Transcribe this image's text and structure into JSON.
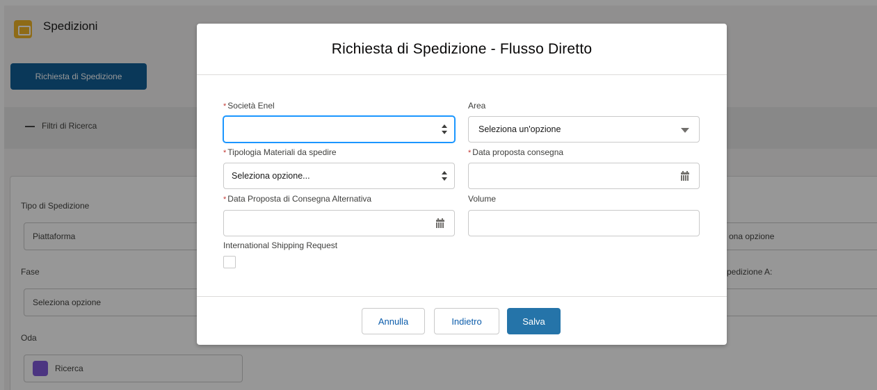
{
  "app": {
    "title": "Spedizioni",
    "icon": "shipment-box-icon",
    "accent": "#f0b323"
  },
  "toolbar": {
    "request_button": "Richiesta di Spedizione"
  },
  "filters": {
    "toggle_label": "Filtri di Ricerca"
  },
  "search_card": {
    "tipo_label": "Tipo di Spedizione",
    "tipo_value": "Piattaforma",
    "fase_label": "Fase",
    "fase_value": "Seleziona opzione",
    "oda_label": "Oda",
    "oda_value": "Ricerca",
    "right_select_partial": "ona opzione",
    "right_label_partial": "pedizione A:"
  },
  "modal": {
    "title": "Richiesta di Spedizione - Flusso Diretto",
    "fields": {
      "societa": {
        "label": "Società Enel",
        "required": true,
        "value": ""
      },
      "area": {
        "label": "Area",
        "required": false,
        "value": "Seleziona un'opzione"
      },
      "tipologia": {
        "label": "Tipologia Materiali da spedire",
        "required": true,
        "value": "Seleziona opzione..."
      },
      "data_consegna": {
        "label": "Data proposta consegna",
        "required": true,
        "value": ""
      },
      "data_alternativa": {
        "label": "Data Proposta di Consegna Alternativa",
        "required": true,
        "value": ""
      },
      "volume": {
        "label": "Volume",
        "required": false,
        "value": ""
      },
      "international": {
        "label": "International Shipping Request",
        "checked": false
      }
    },
    "required_marker": "*",
    "buttons": {
      "cancel": "Annulla",
      "back": "Indietro",
      "save": "Salva"
    }
  },
  "colors": {
    "brand": "#2574a9",
    "focus": "#1b96ff",
    "required": "#c23934",
    "header_button": "#0d5c95"
  }
}
